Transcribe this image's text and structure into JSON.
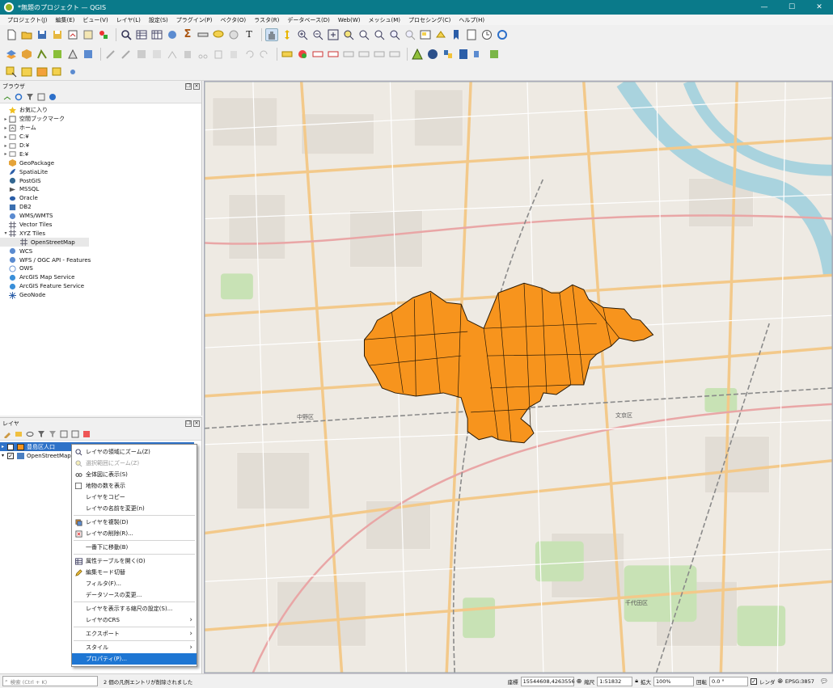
{
  "window": {
    "title": "*無題のプロジェクト — QGIS",
    "controls": [
      "—",
      "☐",
      "✕"
    ]
  },
  "menu": [
    "プロジェクト(J)",
    "編集(E)",
    "ビュー(V)",
    "レイヤ(L)",
    "設定(S)",
    "プラグイン(P)",
    "ベクタ(O)",
    "ラスタ(R)",
    "データベース(D)",
    "Web(W)",
    "メッシュ(M)",
    "プロセシング(C)",
    "ヘルプ(H)"
  ],
  "browser": {
    "title": "ブラウザ",
    "items": [
      {
        "label": "お気に入り",
        "icon": "star-icon",
        "expander": ""
      },
      {
        "label": "空間ブックマーク",
        "icon": "bookmark-icon",
        "expander": "▸"
      },
      {
        "label": "ホーム",
        "icon": "home-folder-icon",
        "expander": "▸"
      },
      {
        "label": "C:¥",
        "icon": "drive-icon",
        "expander": "▸"
      },
      {
        "label": "D:¥",
        "icon": "drive-icon",
        "expander": "▸"
      },
      {
        "label": "E:¥",
        "icon": "drive-icon",
        "expander": "▸"
      },
      {
        "label": "GeoPackage",
        "icon": "geopackage-icon",
        "expander": ""
      },
      {
        "label": "SpatiaLite",
        "icon": "spatialite-icon",
        "expander": ""
      },
      {
        "label": "PostGIS",
        "icon": "postgis-icon",
        "expander": ""
      },
      {
        "label": "MSSQL",
        "icon": "mssql-icon",
        "expander": ""
      },
      {
        "label": "Oracle",
        "icon": "oracle-icon",
        "expander": ""
      },
      {
        "label": "DB2",
        "icon": "db2-icon",
        "expander": ""
      },
      {
        "label": "WMS/WMTS",
        "icon": "wms-icon",
        "expander": ""
      },
      {
        "label": "Vector Tiles",
        "icon": "vector-tiles-icon",
        "expander": ""
      },
      {
        "label": "XYZ Tiles",
        "icon": "xyz-tiles-icon",
        "expander": "▾"
      },
      {
        "label": "OpenStreetMap",
        "icon": "xyz-tiles-icon",
        "expander": "",
        "child": true
      },
      {
        "label": "WCS",
        "icon": "wcs-icon",
        "expander": ""
      },
      {
        "label": "WFS / OGC API - Features",
        "icon": "wfs-icon",
        "expander": ""
      },
      {
        "label": "OWS",
        "icon": "ows-icon",
        "expander": ""
      },
      {
        "label": "ArcGIS Map Service",
        "icon": "arcgis-map-icon",
        "expander": ""
      },
      {
        "label": "ArcGIS Feature Service",
        "icon": "arcgis-feature-icon",
        "expander": ""
      },
      {
        "label": "GeoNode",
        "icon": "geonode-icon",
        "expander": ""
      }
    ]
  },
  "layers_panel": {
    "title": "レイヤ",
    "layers": [
      {
        "name": "豊島区人口",
        "checked": "✓",
        "selected": true,
        "swatch": "#f7941d"
      },
      {
        "name": "OpenStreetMap",
        "checked": "✓",
        "selected": false,
        "swatch": "#4a7fc1"
      }
    ]
  },
  "context_menu": {
    "items": [
      {
        "label": "レイヤの領域にズーム(Z)",
        "icon": "zoom-layer-icon",
        "disabled": false
      },
      {
        "label": "選択範囲にズーム(Z)",
        "icon": "zoom-selection-icon",
        "disabled": true
      },
      {
        "label": "全体図に表示(S)",
        "icon": "overview-icon",
        "disabled": false
      },
      {
        "label": "地物の数を表示",
        "icon": "checkbox-icon",
        "disabled": false
      },
      {
        "label": "レイヤをコピー",
        "icon": "",
        "disabled": false
      },
      {
        "label": "レイヤの名前を変更(n)",
        "icon": "",
        "disabled": false
      },
      {
        "sep": true
      },
      {
        "label": "レイヤを複製(D)",
        "icon": "duplicate-icon",
        "disabled": false
      },
      {
        "label": "レイヤの削除(R)...",
        "icon": "remove-layer-icon",
        "disabled": false
      },
      {
        "sep": true
      },
      {
        "label": "一番下に移動(B)",
        "icon": "",
        "disabled": false
      },
      {
        "sep": true
      },
      {
        "label": "属性テーブルを開く(O)",
        "icon": "attribute-table-icon",
        "disabled": false
      },
      {
        "label": "編集モード切替",
        "icon": "pencil-icon",
        "disabled": false
      },
      {
        "label": "フィルタ(F)...",
        "icon": "",
        "disabled": false
      },
      {
        "label": "データソースの変更...",
        "icon": "",
        "disabled": false
      },
      {
        "sep": true
      },
      {
        "label": "レイヤを表示する縮尺の設定(S)...",
        "icon": "",
        "disabled": false
      },
      {
        "label": "レイヤのCRS",
        "icon": "",
        "disabled": false,
        "submenu": true
      },
      {
        "sep": true
      },
      {
        "label": "エクスポート",
        "icon": "",
        "disabled": false,
        "submenu": true
      },
      {
        "sep": true
      },
      {
        "label": "スタイル",
        "icon": "",
        "disabled": false,
        "submenu": true
      },
      {
        "label": "プロパティ(P)...",
        "icon": "",
        "disabled": false,
        "active": true
      }
    ]
  },
  "map": {
    "labels": [
      "中野区",
      "文京区",
      "千代田区"
    ],
    "polygon_color": "#f7941d"
  },
  "status": {
    "search_placeholder": "検索 (Ctrl + K)",
    "message": "2 個の凡例エントリが削除されました",
    "coord_label": "座標",
    "coord_value": "15544608,4263556",
    "scale_label": "縮尺",
    "scale_value": "1:51832",
    "magnifier_label": "拡大",
    "magnifier_value": "100%",
    "rotation_label": "回転",
    "rotation_value": "0.0 °",
    "render_label": "レンダ",
    "render_checked": "✓",
    "crs": "EPSG:3857"
  }
}
